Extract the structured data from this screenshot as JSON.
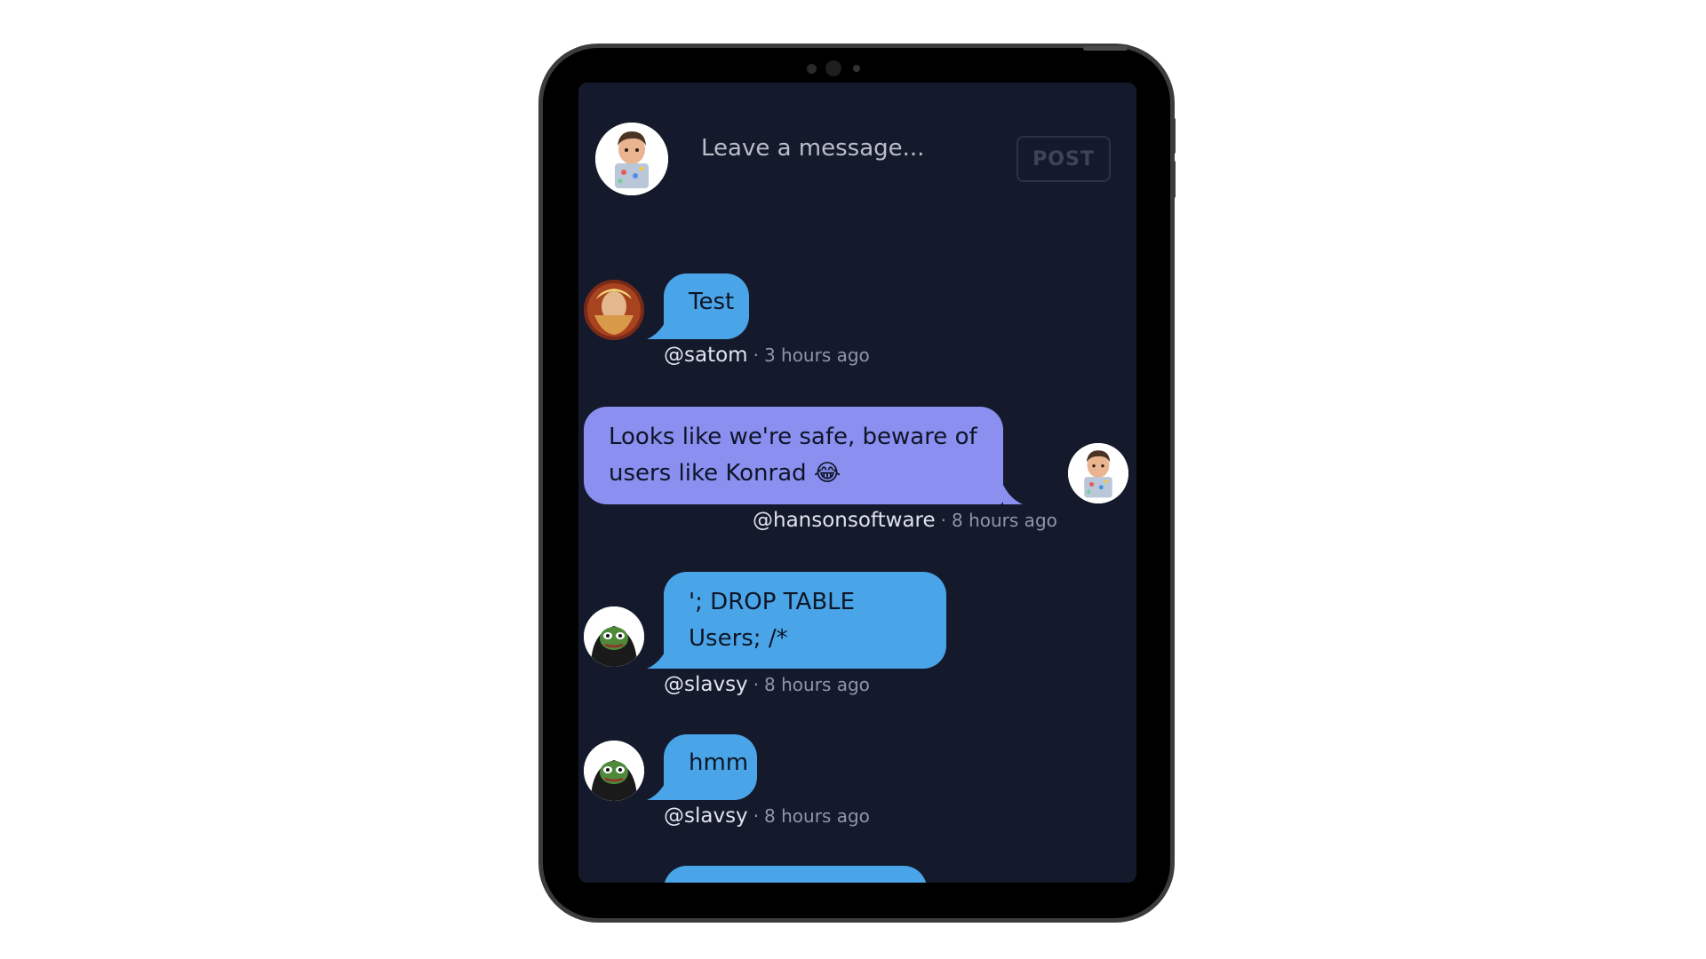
{
  "compose": {
    "placeholder": "Leave a message...",
    "post_label": "POST"
  },
  "messages": [
    {
      "text": "Test",
      "handle": "@satom",
      "separator": "·",
      "time": "3 hours ago",
      "side": "left",
      "color": "#4aa5e8",
      "avatar": "satom-avatar"
    },
    {
      "text": "Looks like we're safe, beware of users like Konrad 😂",
      "handle": "@hansonsoftware",
      "separator": "·",
      "time": "8 hours ago",
      "side": "right",
      "color": "#8a8ff0",
      "avatar": "memoji-avatar"
    },
    {
      "text": "'; DROP TABLE Users; /*",
      "handle": "@slavsy",
      "separator": "·",
      "time": "8 hours ago",
      "side": "left",
      "color": "#4aa5e8",
      "avatar": "pepe-avatar"
    },
    {
      "text": "hmm",
      "handle": "@slavsy",
      "separator": "·",
      "time": "8 hours ago",
      "side": "left",
      "color": "#4aa5e8",
      "avatar": "pepe-avatar"
    }
  ],
  "colors": {
    "screen_bg": "#141a2c",
    "bubble_blue": "#4aa5e8",
    "bubble_purple": "#8a8ff0"
  }
}
